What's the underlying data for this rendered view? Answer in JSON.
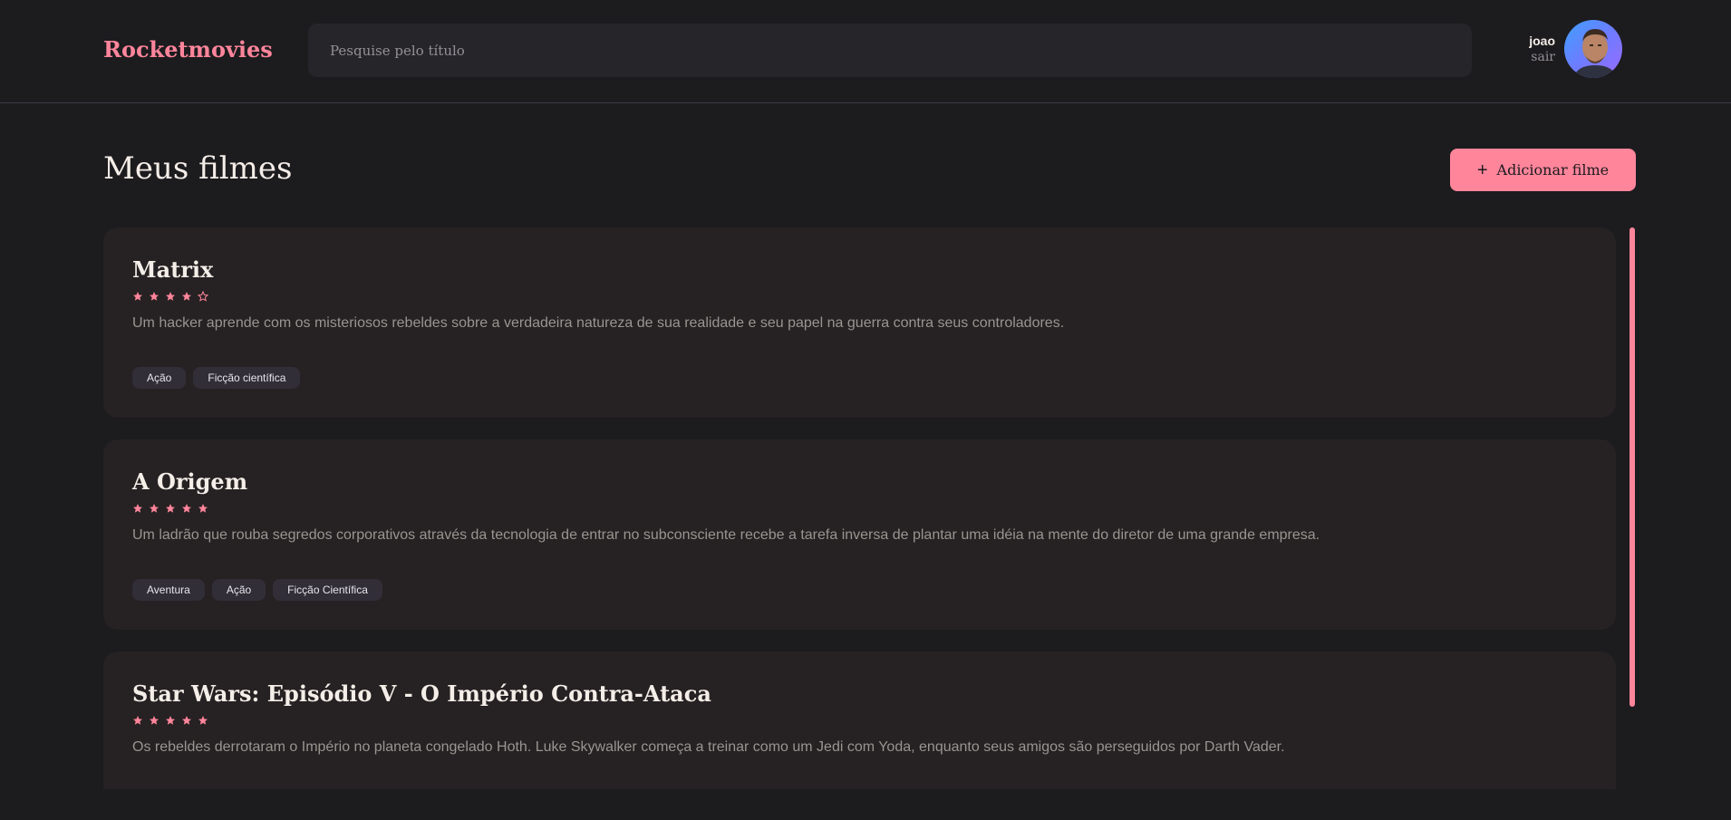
{
  "header": {
    "logo": "Rocketmovies",
    "search_placeholder": "Pesquise pelo título",
    "user_name": "joao",
    "logout_label": "sair"
  },
  "main": {
    "title": "Meus filmes",
    "add_button_label": "Adicionar filme",
    "movies": [
      {
        "title": "Matrix",
        "rating": 4,
        "max_rating": 5,
        "description": "Um hacker aprende com os misteriosos rebeldes sobre a verdadeira natureza de sua realidade e seu papel na guerra contra seus controladores.",
        "tags": [
          "Ação",
          "Ficção científica"
        ]
      },
      {
        "title": "A Origem",
        "rating": 5,
        "max_rating": 5,
        "description": "Um ladrão que rouba segredos corporativos através da tecnologia de entrar no subconsciente recebe a tarefa inversa de plantar uma idéia na mente do diretor de uma grande empresa.",
        "tags": [
          "Aventura",
          "Ação",
          "Ficção Científica"
        ]
      },
      {
        "title": "Star Wars: Episódio V - O Império Contra-Ataca",
        "rating": 5,
        "max_rating": 5,
        "description": "Os rebeldes derrotaram o Império no planeta congelado Hoth. Luke Skywalker começa a treinar como um Jedi com Yoda, enquanto seus amigos são perseguidos por Darth Vader.",
        "tags": []
      }
    ]
  },
  "colors": {
    "accent": "#ff859b",
    "background": "#1c1b1e",
    "card": "#262122",
    "tag": "#312e38"
  },
  "icons": {
    "star_filled": "star-filled-icon",
    "star_empty": "star-empty-icon",
    "plus": "plus-icon"
  }
}
